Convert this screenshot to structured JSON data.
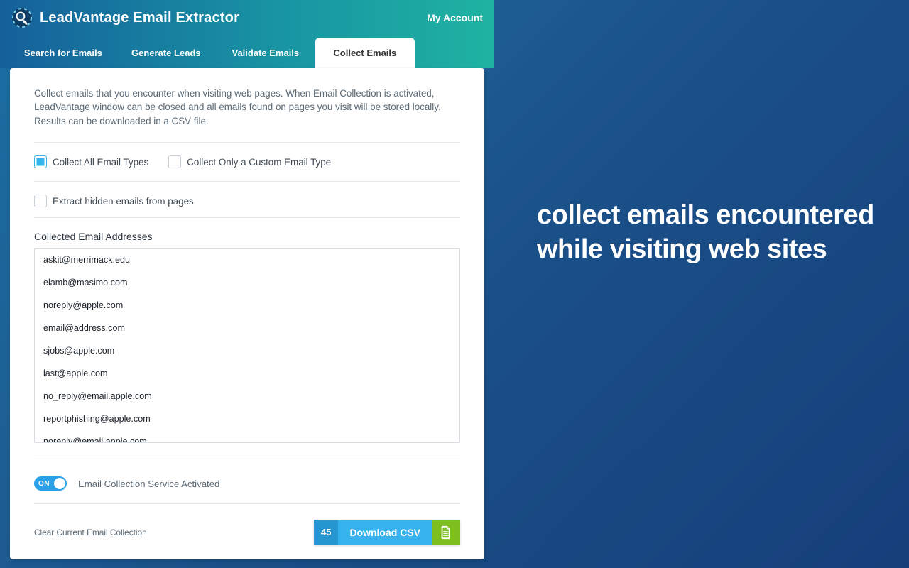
{
  "header": {
    "app_title": "LeadVantage Email Extractor",
    "account_link": "My Account"
  },
  "tabs": [
    {
      "label": "Search for Emails",
      "active": false
    },
    {
      "label": "Generate Leads",
      "active": false
    },
    {
      "label": "Validate Emails",
      "active": false
    },
    {
      "label": "Collect Emails",
      "active": true
    }
  ],
  "panel": {
    "description": "Collect emails that you encounter when visiting web pages. When Email Collection is activated, LeadVantage window can be closed and all emails found on pages you visit will be stored locally. Results can be downloaded in a CSV file.",
    "options": {
      "collect_all": {
        "label": "Collect All Email Types",
        "checked": true
      },
      "collect_custom": {
        "label": "Collect Only a Custom Email Type",
        "checked": false
      },
      "extract_hidden": {
        "label": "Extract hidden emails from pages",
        "checked": false
      }
    },
    "collected_label": "Collected Email Addresses",
    "emails": [
      "askit@merrimack.edu",
      "elamb@masimo.com",
      "noreply@apple.com",
      "email@address.com",
      "sjobs@apple.com",
      "last@apple.com",
      "no_reply@email.apple.com",
      "reportphishing@apple.com",
      "noreply@email.apple.com"
    ],
    "toggle": {
      "on_text": "ON",
      "label": "Email Collection Service Activated",
      "on": true
    },
    "clear_label": "Clear Current Email Collection",
    "download": {
      "count": "45",
      "label": "Download CSV"
    }
  },
  "promo": {
    "headline": "collect emails encountered while visiting web sites"
  }
}
